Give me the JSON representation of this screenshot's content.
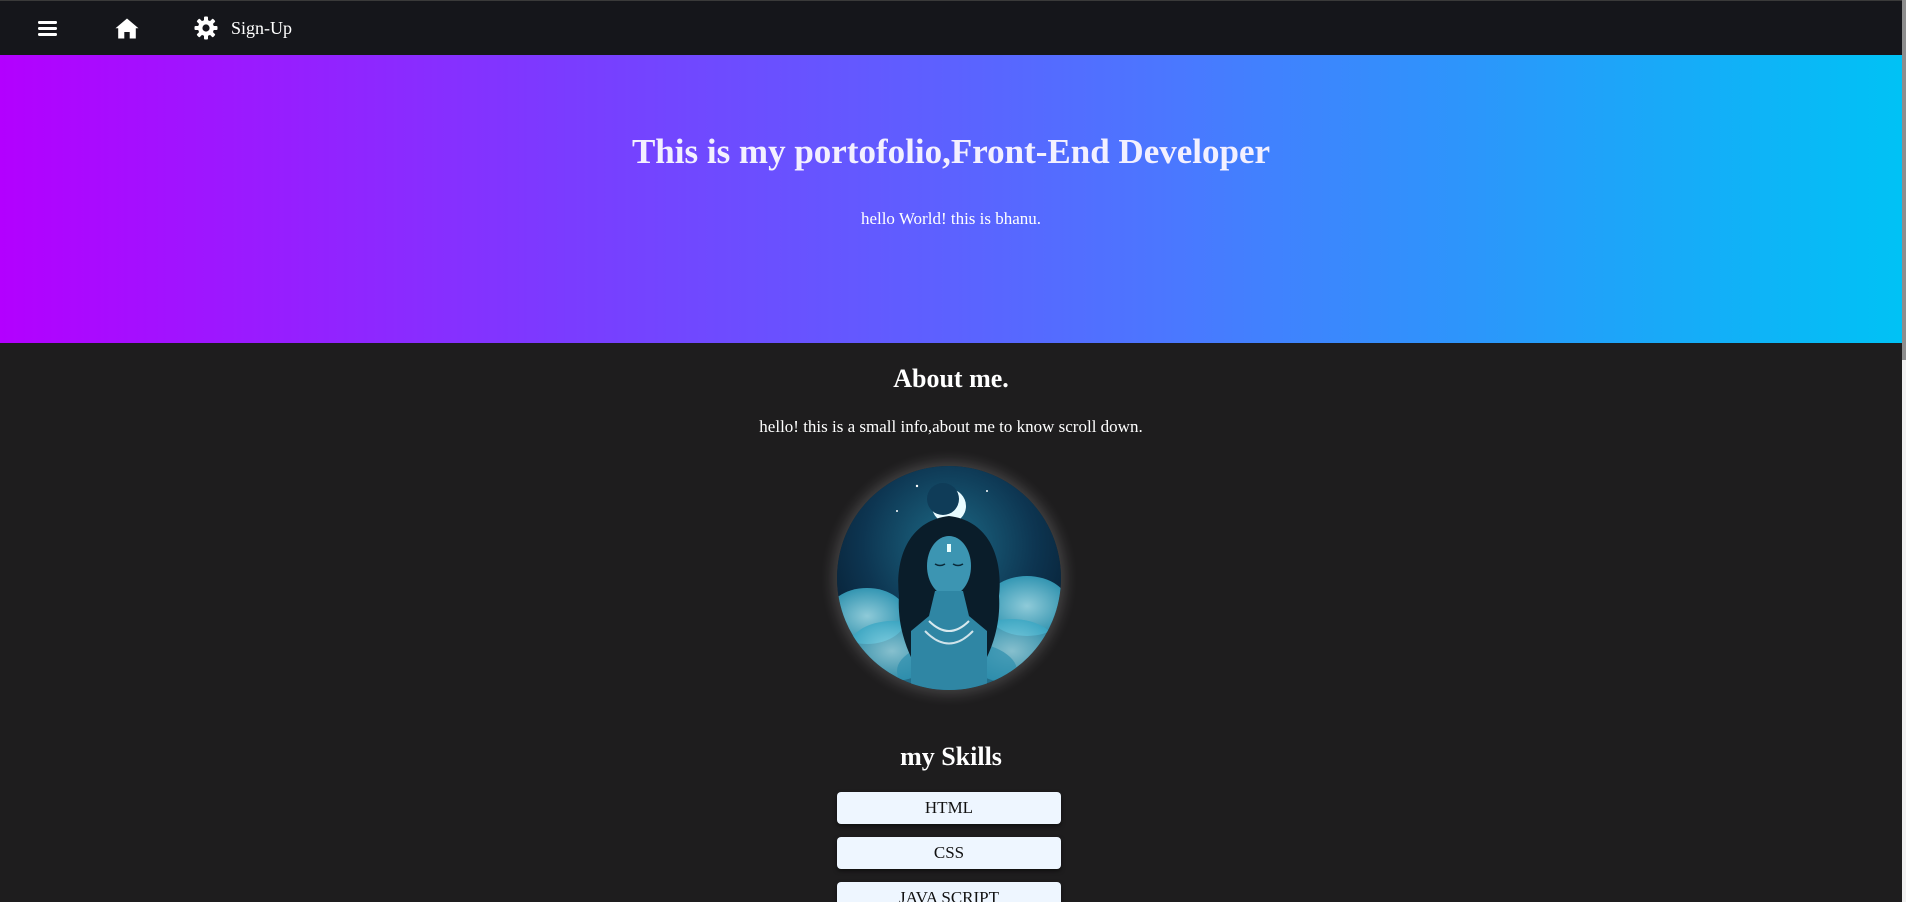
{
  "navbar": {
    "menu_icon": "hamburger-menu-icon",
    "home_icon": "home-icon",
    "settings_icon": "gear-icon",
    "signup_label": "Sign-Up"
  },
  "hero": {
    "title": "This is my portofolio,Front-End Developer",
    "subtitle": "hello World! this is bhanu.",
    "gradient_colors": [
      "#b300ff",
      "#7a3cff",
      "#4a78ff",
      "#00c2f5"
    ]
  },
  "about": {
    "title": "About me.",
    "text": "hello! this is a small info,about me to know scroll down.",
    "avatar": "profile-avatar-image"
  },
  "skills": {
    "title": "my Skills",
    "items": [
      {
        "label": "HTML"
      },
      {
        "label": "CSS"
      },
      {
        "label": "JAVA SCRIPT"
      }
    ]
  },
  "colors": {
    "background": "#1e1d1e",
    "navbar": "#15161b",
    "skill_button": "#eef6ff"
  }
}
